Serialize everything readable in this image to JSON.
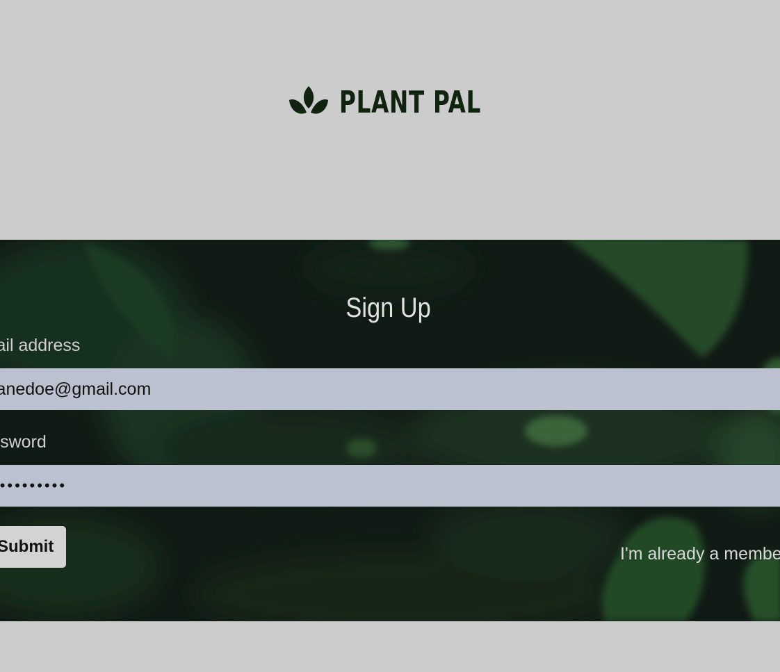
{
  "brand": {
    "name": "PLANT PAL",
    "logo_icon": "sprout-leaves-icon"
  },
  "signup": {
    "title": "Sign Up",
    "email": {
      "label": "Email address",
      "value": "janedoe@gmail.com"
    },
    "password": {
      "label": "Password",
      "value": "••••••••••"
    },
    "submit_label": "Submit",
    "member_link": "I'm already a member"
  },
  "colors": {
    "page_background": "#cccccc",
    "brand_dark_green": "#0f230f",
    "input_background": "#bcc1cf",
    "button_background": "#d3d3d3",
    "form_band_base": "#16241a"
  }
}
